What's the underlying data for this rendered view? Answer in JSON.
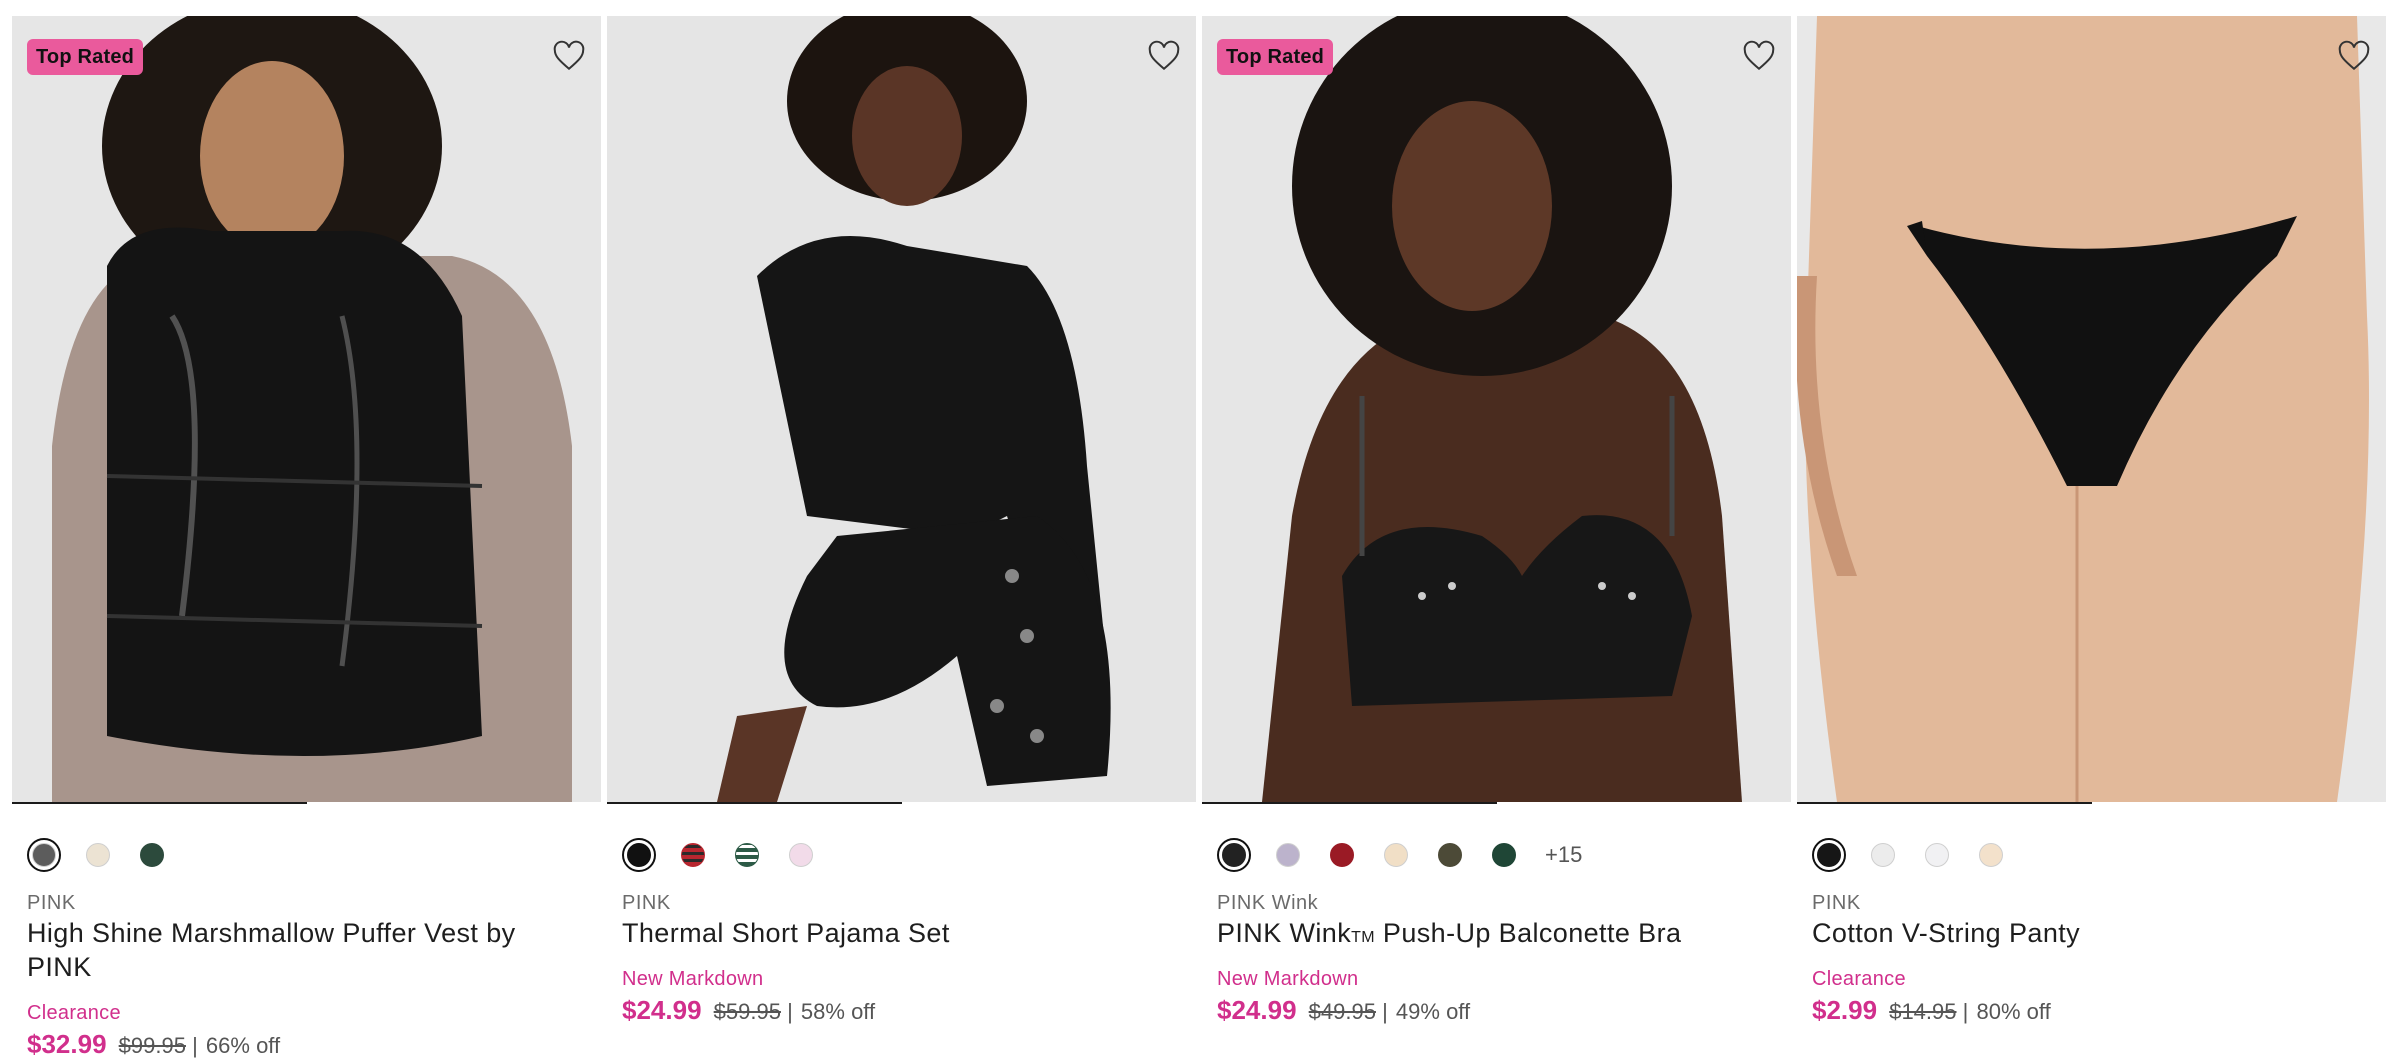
{
  "products": [
    {
      "badge": "Top Rated",
      "brand": "PINK",
      "name": "High Shine Marshmallow Puffer Vest by PINK",
      "status": "Clearance",
      "price": "$32.99",
      "was": "$99.95",
      "sep": "|",
      "off": "66% off",
      "swatches": [
        "#5c5c5c",
        "#ece3d3",
        "#2c4a3c"
      ],
      "more": ""
    },
    {
      "badge": "",
      "brand": "PINK",
      "name": "Thermal Short Pajama Set",
      "status": "New Markdown",
      "price": "$24.99",
      "was": "$59.95",
      "sep": "|",
      "off": "58% off",
      "swatches": [
        "#111111",
        "#b8262f",
        "#2c5a46",
        "#f2dbe9"
      ],
      "more": ""
    },
    {
      "badge": "Top Rated",
      "brand": "PINK Wink",
      "name": "PINK Wink",
      "name_tm": "TM",
      "name_rest": " Push-Up Balconette Bra",
      "status": "New Markdown",
      "price": "$24.99",
      "was": "$49.95",
      "sep": "|",
      "off": "49% off",
      "swatches": [
        "#222222",
        "#bcb3cc",
        "#9a1a25",
        "#f1dfc6",
        "#4c4a37",
        "#1f4636"
      ],
      "more": "+15"
    },
    {
      "badge": "",
      "brand": "PINK",
      "name": "Cotton V-String Panty",
      "status": "Clearance",
      "price": "$2.99",
      "was": "$14.95",
      "sep": "|",
      "off": "80% off",
      "swatches": [
        "#161616",
        "#ececec",
        "#f1f1f3",
        "#f3e1cb"
      ],
      "more": ""
    }
  ],
  "colors": {
    "accent": "#d12f8c",
    "badge_bg": "#ea5a9c",
    "photo_bg": "#e7e7e7"
  },
  "icons": {
    "wishlist": "heart-outline-icon"
  }
}
